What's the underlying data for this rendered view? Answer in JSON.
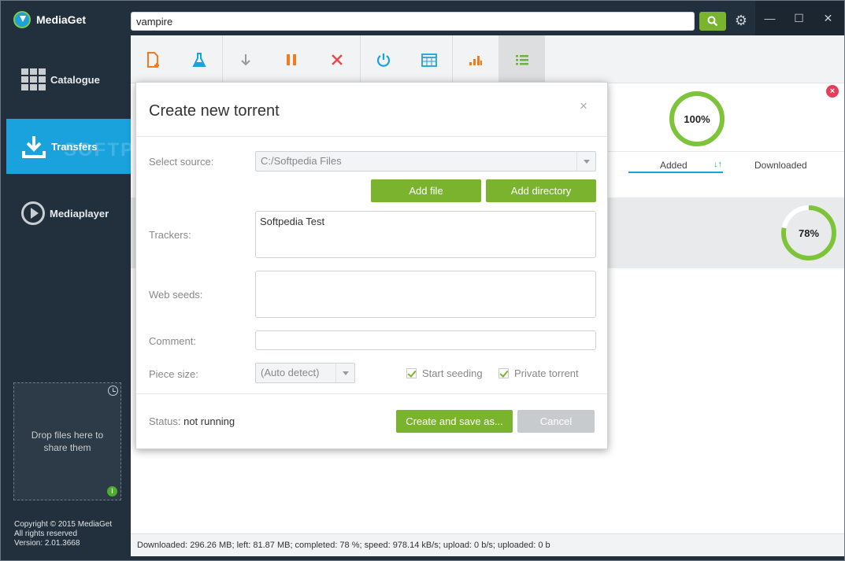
{
  "app": {
    "name": "MediaGet"
  },
  "search": {
    "value": "vampire"
  },
  "window_controls": {
    "minimize": "—",
    "maximize": "☐",
    "close": "✕"
  },
  "sidebar": {
    "items": [
      {
        "label": "Catalogue",
        "icon": "grid-icon",
        "active": false
      },
      {
        "label": "Transfers",
        "icon": "download-icon",
        "active": true
      },
      {
        "label": "Mediaplayer",
        "icon": "play-icon",
        "active": false
      }
    ],
    "dropzone_text": "Drop files here to share them",
    "copyright_lines": [
      "Copyright © 2015 MediaGet",
      "All rights reserved",
      "Version: 2.01.3668"
    ]
  },
  "toolbar": {
    "buttons": [
      {
        "icon": "new-torrent-icon",
        "color": "#f07c1e"
      },
      {
        "icon": "flask-icon",
        "color": "#1aa2dc"
      },
      {
        "icon": "arrow-down-icon",
        "color": "#999999"
      },
      {
        "icon": "pause-icon",
        "color": "#f07c1e"
      },
      {
        "icon": "cross-icon",
        "color": "#e84b4b"
      },
      {
        "icon": "power-icon",
        "color": "#1aa2dc"
      },
      {
        "icon": "calendar-icon",
        "color": "#1aa2dc"
      },
      {
        "icon": "bar-chart-icon",
        "color": "#f07c1e"
      },
      {
        "icon": "list-icon",
        "color": "#6bb33a"
      }
    ]
  },
  "transfers": {
    "tabs": [
      "Added",
      "Downloaded"
    ],
    "rings": [
      {
        "percent": 100,
        "label": "100%"
      },
      {
        "percent": 78,
        "label": "78%"
      }
    ]
  },
  "dialog": {
    "title": "Create new torrent",
    "close": "×",
    "select_source_label": "Select source:",
    "source_value": "C:/Softpedia Files",
    "add_file": "Add file",
    "add_directory": "Add directory",
    "trackers_label": "Trackers:",
    "trackers_value": "Softpedia Test",
    "web_seeds_label": "Web seeds:",
    "web_seeds_value": "",
    "comment_label": "Comment:",
    "comment_value": "",
    "piece_size_label": "Piece size:",
    "piece_size_value": "(Auto detect)",
    "start_seeding": "Start seeding",
    "private_torrent": "Private torrent",
    "status_label": "Status:",
    "status_value": "not running",
    "create_save": "Create and save as...",
    "cancel": "Cancel"
  },
  "statusbar": {
    "text": "Downloaded: 296.26 MB; left: 81.87 MB; completed: 78 %; speed: 978.14 kB/s; upload: 0 b/s; uploaded: 0 b"
  },
  "watermark": "SOFTPEDIA",
  "colors": {
    "accent_blue": "#1aa2dc",
    "accent_green": "#7ab32e",
    "sidebar_bg": "#22303d"
  }
}
